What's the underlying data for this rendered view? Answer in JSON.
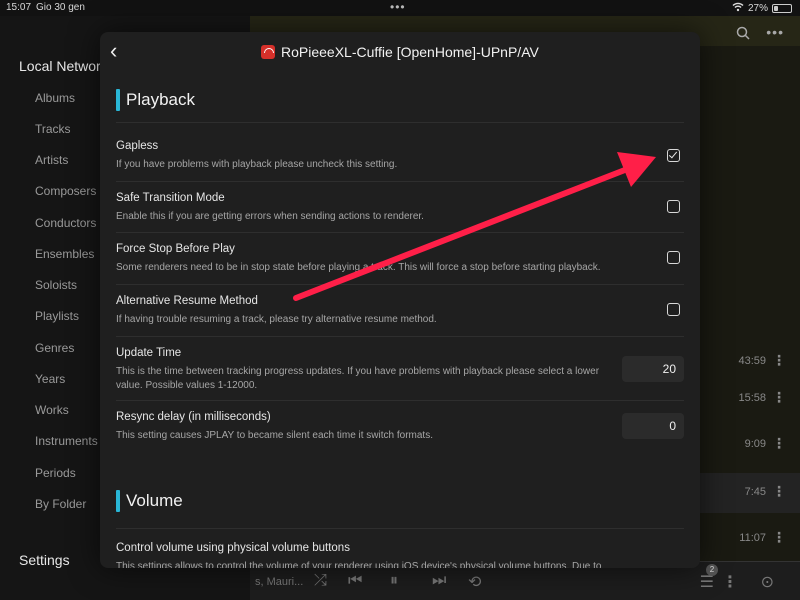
{
  "status_bar": {
    "time": "15:07",
    "date": "Gio 30 gen",
    "battery": "27%",
    "battery_level": 0.27
  },
  "sidebar": {
    "section_title": "Local Network",
    "items": [
      {
        "label": "Albums"
      },
      {
        "label": "Tracks"
      },
      {
        "label": "Artists"
      },
      {
        "label": "Composers"
      },
      {
        "label": "Conductors"
      },
      {
        "label": "Ensembles"
      },
      {
        "label": "Soloists"
      },
      {
        "label": "Playlists"
      },
      {
        "label": "Genres"
      },
      {
        "label": "Years"
      },
      {
        "label": "Works"
      },
      {
        "label": "Instruments"
      },
      {
        "label": "Periods"
      },
      {
        "label": "By Folder"
      }
    ],
    "settings_label": "Settings"
  },
  "background": {
    "durations": [
      "43:59",
      "15:58",
      "9:09",
      "7:45",
      "11:07"
    ],
    "player_text": "s, Mauri...",
    "queue_count": "2"
  },
  "modal": {
    "title": "RoPieeeXL-Cuffie [OpenHome]-UPnP/AV",
    "playback_section": "Playback",
    "volume_section": "Volume",
    "settings": [
      {
        "title": "Gapless",
        "description": "If you have problems with playback please uncheck this setting.",
        "checked": true
      },
      {
        "title": "Safe Transition Mode",
        "description": "Enable this if you are getting errors when sending actions to renderer.",
        "checked": false
      },
      {
        "title": "Force Stop Before Play",
        "description": "Some renderers need to be in stop state before playing a track. This will force a stop before starting playback.",
        "checked": false
      },
      {
        "title": "Alternative Resume Method",
        "description": "If having trouble resuming a track, please try alternative resume method.",
        "checked": false
      },
      {
        "title": "Update Time",
        "description": "This is the time between tracking progress updates. If you have problems with playback please select a lower value. Possible values 1-12000.",
        "value": "20"
      },
      {
        "title": "Resync delay (in milliseconds)",
        "description": "This setting causes JPLAY to became silent each time it switch formats.",
        "value": "0"
      }
    ],
    "volume_setting": {
      "title": "Control volume using physical volume buttons",
      "description": "This settings allows to control the volume of your renderer using iOS device's physical volume buttons. Due to"
    }
  },
  "colors": {
    "accent": "#29b6d6",
    "arrow": "#ff1f48",
    "device_icon": "#d6302a"
  }
}
